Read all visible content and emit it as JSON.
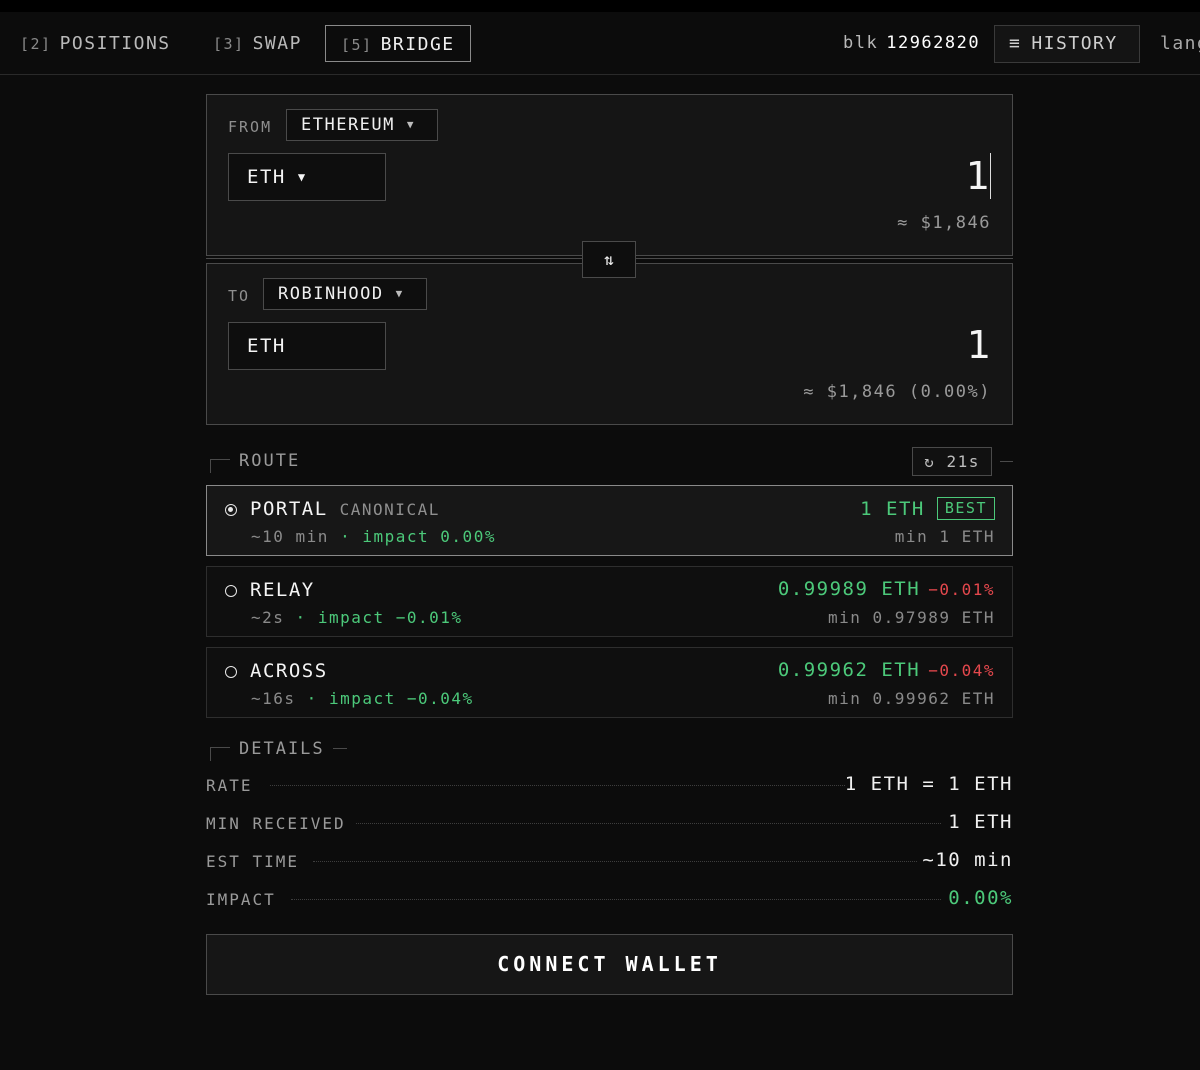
{
  "nav": {
    "tabs": [
      {
        "key": "[2]",
        "label": "POSITIONS"
      },
      {
        "key": "[3]",
        "label": "SWAP"
      },
      {
        "key": "[5]",
        "label": "BRIDGE"
      }
    ],
    "block_label": "blk",
    "block_number": "12962820",
    "history_icon": "≡",
    "history_label": "HISTORY",
    "lang_label": "lang"
  },
  "from": {
    "label": "FROM",
    "chain": "ETHEREUM",
    "token": "ETH",
    "amount": "1",
    "usd": "≈ $1,846"
  },
  "swap_icon": "⇅",
  "to": {
    "label": "TO",
    "chain": "ROBINHOOD",
    "token": "ETH",
    "amount": "1",
    "usd": "≈ $1,846 (0.00%)"
  },
  "route_section": {
    "title": "ROUTE",
    "refresh_icon": "↻",
    "refresh_label": "21s"
  },
  "routes": [
    {
      "name": "PORTAL",
      "tag": "CANONICAL",
      "time": "~10 min",
      "sep": "·",
      "impact": "impact 0.00%",
      "amount": "1 ETH",
      "diff": "",
      "badge": "BEST",
      "min": "min 1 ETH",
      "selected": true
    },
    {
      "name": "RELAY",
      "tag": "",
      "time": "~2s",
      "sep": "·",
      "impact": "impact −0.01%",
      "amount": "0.99989 ETH",
      "diff": "−0.01%",
      "badge": "",
      "min": "min 0.97989 ETH",
      "selected": false
    },
    {
      "name": "ACROSS",
      "tag": "",
      "time": "~16s",
      "sep": "·",
      "impact": "impact −0.04%",
      "amount": "0.99962 ETH",
      "diff": "−0.04%",
      "badge": "",
      "min": "min 0.99962 ETH",
      "selected": false
    }
  ],
  "details_section": {
    "title": "DETAILS"
  },
  "details": {
    "rate_label": "RATE",
    "rate_value": "1 ETH = 1 ETH",
    "min_label": "MIN RECEIVED",
    "min_value": "1 ETH",
    "time_label": "EST TIME",
    "time_value": "~10 min",
    "impact_label": "IMPACT",
    "impact_value": "0.00%"
  },
  "connect_label": "CONNECT WALLET",
  "colors": {
    "accent_green": "#4cc97a",
    "negative_red": "#e5484d",
    "background": "#0c0c0c"
  }
}
